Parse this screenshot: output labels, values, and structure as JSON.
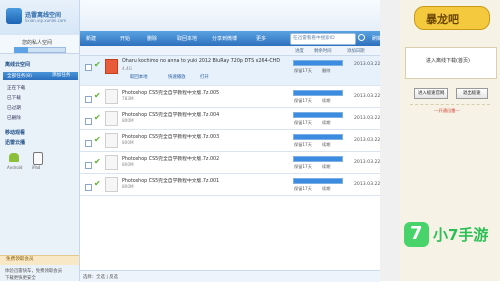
{
  "app": {
    "logo_title": "迅雷离线空间",
    "logo_sub": "lixian.vip.xunlei.com",
    "user_name": "您的私人空间",
    "user_space": "6.12GB/105GB(5%)"
  },
  "sidebar": {
    "section_title": "离线云空间",
    "all_tasks": "全部任务(8)",
    "add_task": "添加任务",
    "items": [
      "正在下载",
      "已下载",
      "已过期",
      "已删除"
    ],
    "subscribe_title": "移动观看",
    "mobile_title": "迅雷云播",
    "android_label": "Android",
    "ios_label": "iPad",
    "promo_title": "免费领取会员",
    "promo_line1": "体验迅雷快车，免费领取会员",
    "promo_line2": "下载更快更安全"
  },
  "toolbar": {
    "new": "新建",
    "start": "开始",
    "delete": "删除",
    "save_local": "取回本地",
    "share": "分享到微博",
    "more": "更多",
    "search_placeholder": "在迅雷看看中搜索ID",
    "refresh": "刷新"
  },
  "columns": {
    "progress": "进度",
    "status": "剩余时间",
    "date": "添加日期"
  },
  "rows": [
    {
      "name": "Oharu kochimo no anna to yuki 2012 BluRay 720p DTS x264-CHD",
      "size": "4.4G",
      "keep": "保留17天",
      "delete_label": "删除",
      "date": "2013.03.22",
      "progress": 1.0,
      "actions": [
        "取回本地",
        "快速播放",
        "打开"
      ]
    },
    {
      "name": "Photoshop CS5完全自学教程中文版.7z.005",
      "size": "783M",
      "keep": "保留17天",
      "delete_label": "续期",
      "date": "2013.03.22",
      "progress": 1.0
    },
    {
      "name": "Photoshop CS5完全自学教程中文版.7z.004",
      "size": "800M",
      "keep": "保留17天",
      "delete_label": "续期",
      "date": "2013.03.22",
      "progress": 1.0
    },
    {
      "name": "Photoshop CS5完全自学教程中文版.7z.003",
      "size": "800M",
      "keep": "保留17天",
      "delete_label": "续期",
      "date": "2013.03.22",
      "progress": 1.0
    },
    {
      "name": "Photoshop CS5完全自学教程中文版.7z.002",
      "size": "800M",
      "keep": "保留17天",
      "delete_label": "续期",
      "date": "2013.03.22",
      "progress": 1.0
    },
    {
      "name": "Photoshop CS5完全自学教程中文版.7z.001",
      "size": "800M",
      "keep": "保留17天",
      "delete_label": "续期",
      "date": "2013.03.22",
      "progress": 1.0
    }
  ],
  "status": "选择：全选 | 反选",
  "right": {
    "logo": "暴龙吧",
    "box_text": "进入离线下载(首页)",
    "btn1": "进入极速官网",
    "btn2": "退出极速",
    "tip": "---开通迅雷---"
  },
  "watermark": {
    "seven": "7",
    "text": "小7手游"
  }
}
